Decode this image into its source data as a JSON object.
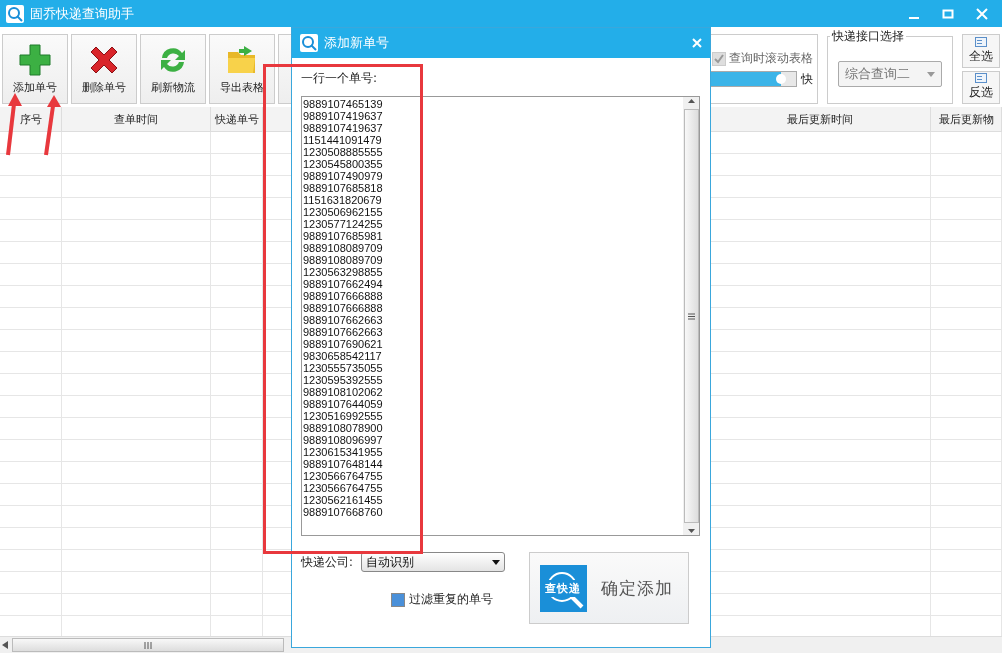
{
  "window": {
    "title": "固乔快递查询助手"
  },
  "toolbar": {
    "buttons": [
      {
        "label": "添加单号"
      },
      {
        "label": "删除单号"
      },
      {
        "label": "刷新物流"
      },
      {
        "label": "导出表格"
      }
    ],
    "scroll_option": {
      "label": "查询时滚动表格",
      "checked": true,
      "disabled": true
    },
    "speed": {
      "level": 0.85,
      "label": "快"
    },
    "api_group": {
      "title": "快递接口选择",
      "value": "综合查询二"
    },
    "select_buttons": [
      "全选",
      "反选"
    ]
  },
  "table": {
    "columns": [
      "序号",
      "查单时间",
      "快递单号",
      "最后更新时间",
      "最后更新物"
    ]
  },
  "dialog": {
    "title": "添加新单号",
    "prompt": "一行一个单号:",
    "numbers": [
      "9889107465139",
      "9889107419637",
      "9889107419637",
      "1151441091479",
      "1230508885555",
      "1230545800355",
      "9889107490979",
      "9889107685818",
      "1151631820679",
      "1230506962155",
      "1230577124255",
      "9889107685981",
      "9889108089709",
      "9889108089709",
      "1230563298855",
      "9889107662494",
      "9889107666888",
      "9889107666888",
      "9889107662663",
      "9889107662663",
      "9889107690621",
      "9830658542117",
      "1230555735055",
      "1230595392555",
      "9889108102062",
      "9889107644059",
      "1230516992555",
      "9889108078900",
      "9889108096997",
      "1230615341955",
      "9889107648144",
      "1230566764755",
      "1230566764755",
      "1230562161455",
      "9889107668760"
    ],
    "company_label": "快递公司:",
    "company_value": "自动识别",
    "filter": {
      "label": "过滤重复的单号",
      "checked": true
    },
    "confirm": {
      "label": "确定添加",
      "logo_text": "查快递"
    }
  }
}
